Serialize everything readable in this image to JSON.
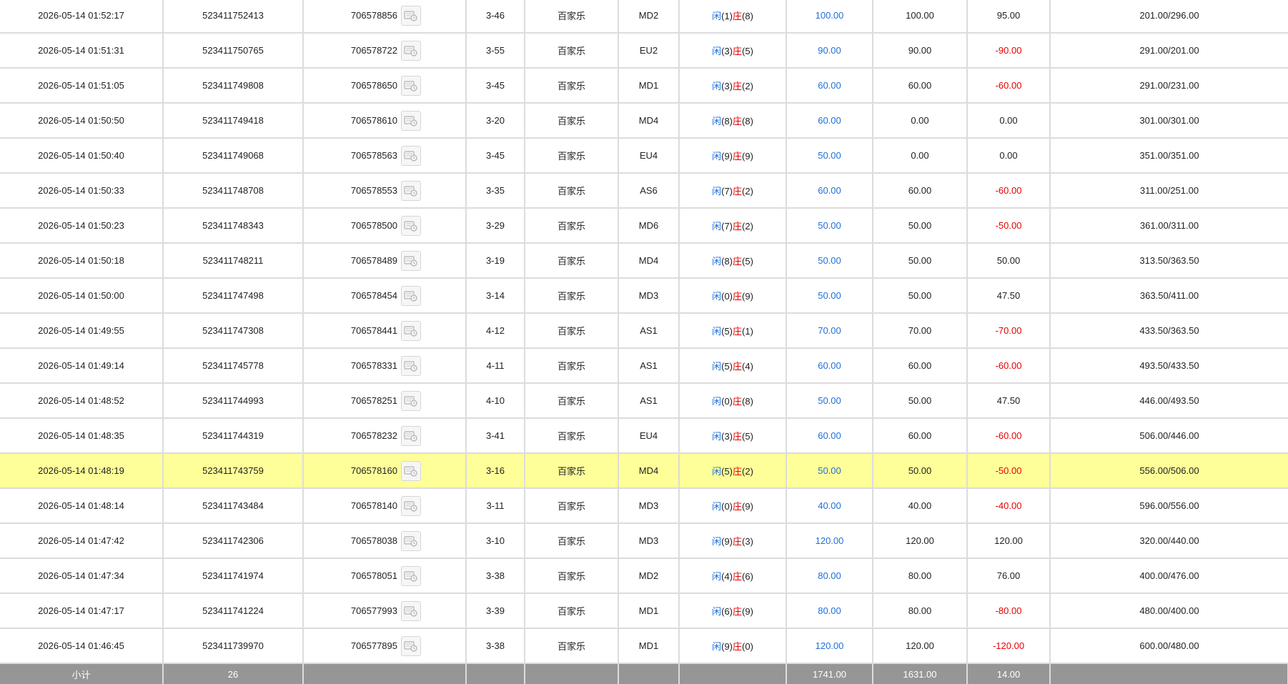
{
  "labels": {
    "player": "闲",
    "banker": "庄"
  },
  "colors": {
    "blue": "#1e6fdc",
    "red": "#e60000",
    "highlight": "#ffff99",
    "subtotal_bg": "#969696"
  },
  "rows": [
    {
      "time": "2026-05-14 01:52:17",
      "bet_id": "523411752413",
      "round": "706578856",
      "shoe": "3-46",
      "game": "百家乐",
      "table": "MD2",
      "player": "1",
      "banker": "8",
      "bet": "100.00",
      "valid": "100.00",
      "win": "95.00",
      "win_neg": false,
      "balance": "201.00/296.00"
    },
    {
      "time": "2026-05-14 01:51:31",
      "bet_id": "523411750765",
      "round": "706578722",
      "shoe": "3-55",
      "game": "百家乐",
      "table": "EU2",
      "player": "3",
      "banker": "5",
      "bet": "90.00",
      "valid": "90.00",
      "win": "-90.00",
      "win_neg": true,
      "balance": "291.00/201.00"
    },
    {
      "time": "2026-05-14 01:51:05",
      "bet_id": "523411749808",
      "round": "706578650",
      "shoe": "3-45",
      "game": "百家乐",
      "table": "MD1",
      "player": "3",
      "banker": "2",
      "bet": "60.00",
      "valid": "60.00",
      "win": "-60.00",
      "win_neg": true,
      "balance": "291.00/231.00"
    },
    {
      "time": "2026-05-14 01:50:50",
      "bet_id": "523411749418",
      "round": "706578610",
      "shoe": "3-20",
      "game": "百家乐",
      "table": "MD4",
      "player": "8",
      "banker": "8",
      "bet": "60.00",
      "valid": "0.00",
      "win": "0.00",
      "win_neg": false,
      "balance": "301.00/301.00"
    },
    {
      "time": "2026-05-14 01:50:40",
      "bet_id": "523411749068",
      "round": "706578563",
      "shoe": "3-45",
      "game": "百家乐",
      "table": "EU4",
      "player": "9",
      "banker": "9",
      "bet": "50.00",
      "valid": "0.00",
      "win": "0.00",
      "win_neg": false,
      "balance": "351.00/351.00"
    },
    {
      "time": "2026-05-14 01:50:33",
      "bet_id": "523411748708",
      "round": "706578553",
      "shoe": "3-35",
      "game": "百家乐",
      "table": "AS6",
      "player": "7",
      "banker": "2",
      "bet": "60.00",
      "valid": "60.00",
      "win": "-60.00",
      "win_neg": true,
      "balance": "311.00/251.00"
    },
    {
      "time": "2026-05-14 01:50:23",
      "bet_id": "523411748343",
      "round": "706578500",
      "shoe": "3-29",
      "game": "百家乐",
      "table": "MD6",
      "player": "7",
      "banker": "2",
      "bet": "50.00",
      "valid": "50.00",
      "win": "-50.00",
      "win_neg": true,
      "balance": "361.00/311.00"
    },
    {
      "time": "2026-05-14 01:50:18",
      "bet_id": "523411748211",
      "round": "706578489",
      "shoe": "3-19",
      "game": "百家乐",
      "table": "MD4",
      "player": "8",
      "banker": "5",
      "bet": "50.00",
      "valid": "50.00",
      "win": "50.00",
      "win_neg": false,
      "balance": "313.50/363.50"
    },
    {
      "time": "2026-05-14 01:50:00",
      "bet_id": "523411747498",
      "round": "706578454",
      "shoe": "3-14",
      "game": "百家乐",
      "table": "MD3",
      "player": "0",
      "banker": "9",
      "bet": "50.00",
      "valid": "50.00",
      "win": "47.50",
      "win_neg": false,
      "balance": "363.50/411.00"
    },
    {
      "time": "2026-05-14 01:49:55",
      "bet_id": "523411747308",
      "round": "706578441",
      "shoe": "4-12",
      "game": "百家乐",
      "table": "AS1",
      "player": "5",
      "banker": "1",
      "bet": "70.00",
      "valid": "70.00",
      "win": "-70.00",
      "win_neg": true,
      "balance": "433.50/363.50"
    },
    {
      "time": "2026-05-14 01:49:14",
      "bet_id": "523411745778",
      "round": "706578331",
      "shoe": "4-11",
      "game": "百家乐",
      "table": "AS1",
      "player": "5",
      "banker": "4",
      "bet": "60.00",
      "valid": "60.00",
      "win": "-60.00",
      "win_neg": true,
      "balance": "493.50/433.50"
    },
    {
      "time": "2026-05-14 01:48:52",
      "bet_id": "523411744993",
      "round": "706578251",
      "shoe": "4-10",
      "game": "百家乐",
      "table": "AS1",
      "player": "0",
      "banker": "8",
      "bet": "50.00",
      "valid": "50.00",
      "win": "47.50",
      "win_neg": false,
      "balance": "446.00/493.50"
    },
    {
      "time": "2026-05-14 01:48:35",
      "bet_id": "523411744319",
      "round": "706578232",
      "shoe": "3-41",
      "game": "百家乐",
      "table": "EU4",
      "player": "3",
      "banker": "5",
      "bet": "60.00",
      "valid": "60.00",
      "win": "-60.00",
      "win_neg": true,
      "balance": "506.00/446.00"
    },
    {
      "time": "2026-05-14 01:48:19",
      "bet_id": "523411743759",
      "round": "706578160",
      "shoe": "3-16",
      "game": "百家乐",
      "table": "MD4",
      "player": "5",
      "banker": "2",
      "bet": "50.00",
      "valid": "50.00",
      "win": "-50.00",
      "win_neg": true,
      "balance": "556.00/506.00",
      "highlight": true
    },
    {
      "time": "2026-05-14 01:48:14",
      "bet_id": "523411743484",
      "round": "706578140",
      "shoe": "3-11",
      "game": "百家乐",
      "table": "MD3",
      "player": "0",
      "banker": "9",
      "bet": "40.00",
      "valid": "40.00",
      "win": "-40.00",
      "win_neg": true,
      "balance": "596.00/556.00"
    },
    {
      "time": "2026-05-14 01:47:42",
      "bet_id": "523411742306",
      "round": "706578038",
      "shoe": "3-10",
      "game": "百家乐",
      "table": "MD3",
      "player": "9",
      "banker": "3",
      "bet": "120.00",
      "valid": "120.00",
      "win": "120.00",
      "win_neg": false,
      "balance": "320.00/440.00"
    },
    {
      "time": "2026-05-14 01:47:34",
      "bet_id": "523411741974",
      "round": "706578051",
      "shoe": "3-38",
      "game": "百家乐",
      "table": "MD2",
      "player": "4",
      "banker": "6",
      "bet": "80.00",
      "valid": "80.00",
      "win": "76.00",
      "win_neg": false,
      "balance": "400.00/476.00"
    },
    {
      "time": "2026-05-14 01:47:17",
      "bet_id": "523411741224",
      "round": "706577993",
      "shoe": "3-39",
      "game": "百家乐",
      "table": "MD1",
      "player": "6",
      "banker": "9",
      "bet": "80.00",
      "valid": "80.00",
      "win": "-80.00",
      "win_neg": true,
      "balance": "480.00/400.00"
    },
    {
      "time": "2026-05-14 01:46:45",
      "bet_id": "523411739970",
      "round": "706577895",
      "shoe": "3-38",
      "game": "百家乐",
      "table": "MD1",
      "player": "9",
      "banker": "0",
      "bet": "120.00",
      "valid": "120.00",
      "win": "-120.00",
      "win_neg": true,
      "balance": "600.00/480.00"
    }
  ],
  "subtotal": {
    "label": "小计",
    "count": "26",
    "bet": "1741.00",
    "valid": "1631.00",
    "win": "14.00"
  }
}
